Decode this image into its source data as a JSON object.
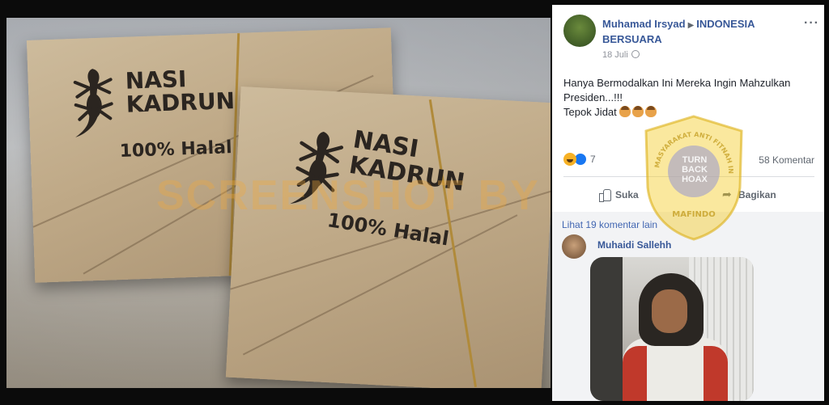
{
  "viewer": {
    "packet_name_line1": "NASI",
    "packet_name_line2": "KADRUN",
    "packet_halal": "100% Halal",
    "watermark": "SCREENSHOT BY"
  },
  "post": {
    "author": "Muhamad Irsyad",
    "group": "INDONESIA BERSUARA",
    "date": "18 Juli",
    "text_line1": "Hanya Bermodalkan Ini Mereka Ingin Mahzulkan Presiden...!!!",
    "text_line2": "Tepok Jidat",
    "reaction_count": "7",
    "comment_count": "58 Komentar",
    "like_label": "Suka",
    "share_label": "Bagikan",
    "more_comments": "Lihat 19 komentar lain",
    "commenter": "Muhaidi Sallehh"
  },
  "badge": {
    "org_arc": "MASYARAKAT ANTI FITNAH INDONESIA",
    "turn_line1": "TURN",
    "turn_line2": "BACK",
    "turn_line3": "HOAX",
    "org_bottom": "MAFINDO"
  },
  "colors": {
    "link": "#385898",
    "muted": "#90949c",
    "badge_gold": "#c9a014"
  }
}
